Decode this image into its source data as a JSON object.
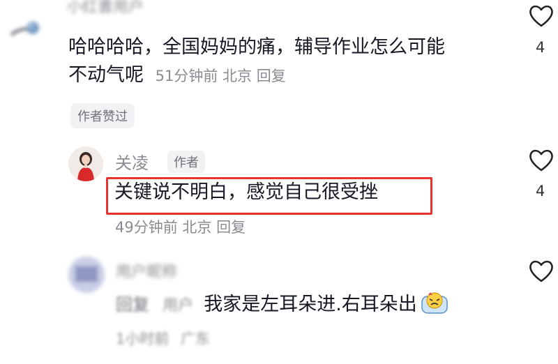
{
  "comment1": {
    "username": "小红書用户",
    "text_line1": "哈哈哈哈，全国妈妈的痛，辅导作业怎么可能",
    "text_line2": "不动气呢",
    "time": "51分钟前",
    "location": "北京",
    "reply": "回复",
    "liked_chip": "作者赞过",
    "like_count": "4"
  },
  "reply1": {
    "username": "关凌",
    "author_chip": "作者",
    "text": "关键说不明白，感觉自己很受挫",
    "time": "49分钟前",
    "location": "北京",
    "reply": "回复",
    "like_count": "4"
  },
  "comment2": {
    "username": "用户昵称",
    "prefix": "回复",
    "mention": "用户",
    "text": "我家是左耳朵进.右耳朵出",
    "emoji": "crying-face-emoji",
    "time": "1小时前",
    "location": "广东"
  },
  "colors": {
    "highlight": "#e4342c",
    "meta_gray": "#8a8b91",
    "chip_bg": "#f2f2f4"
  }
}
